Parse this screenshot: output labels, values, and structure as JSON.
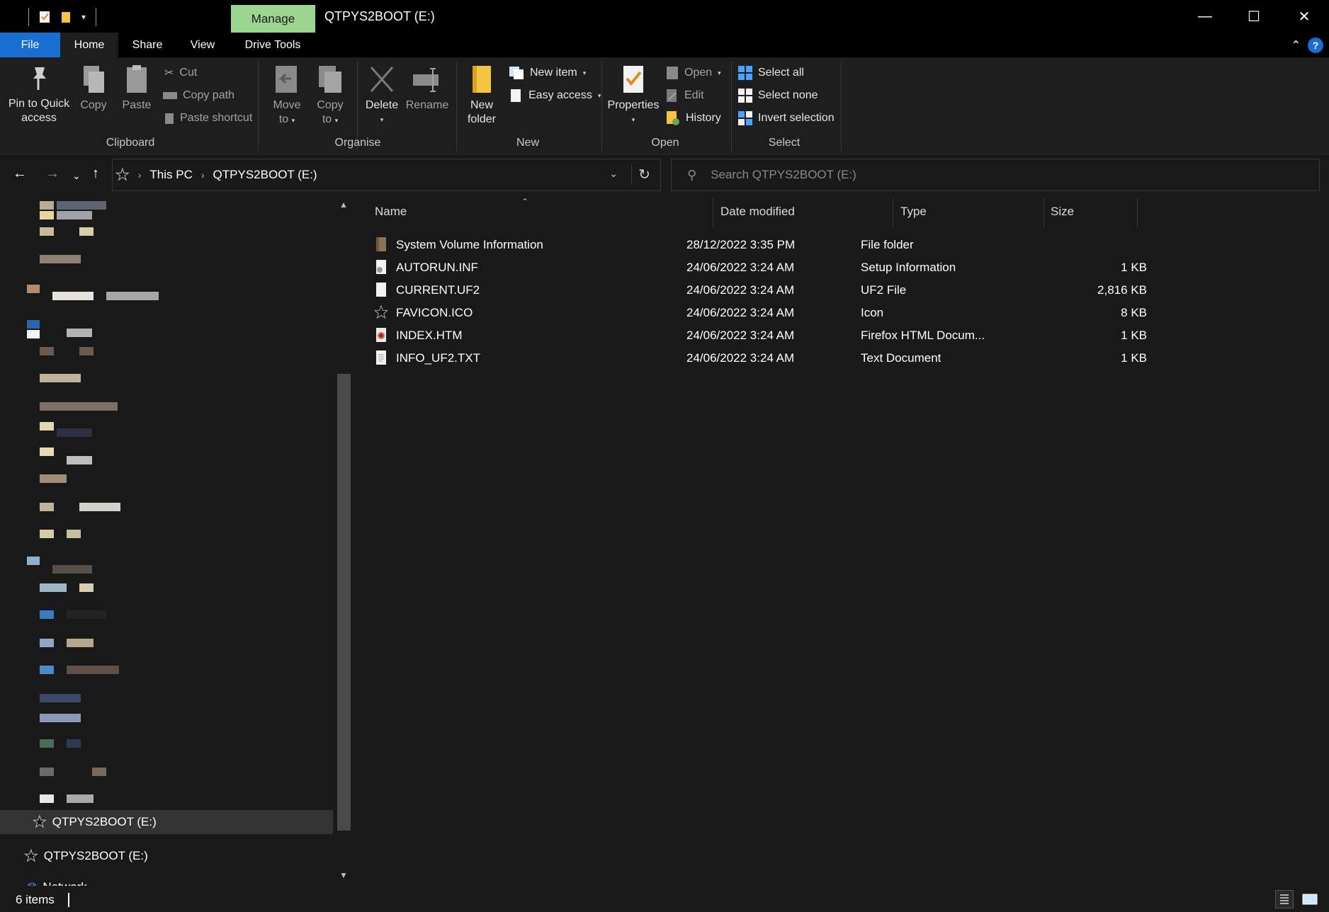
{
  "titlebar": {
    "manage_tab": "Manage",
    "title": "QTPYS2BOOT (E:)",
    "minimize_glyph": "—",
    "maximize_glyph": "☐",
    "close_glyph": "✕"
  },
  "tabs": {
    "file": "File",
    "home": "Home",
    "share": "Share",
    "view": "View",
    "drive_tools": "Drive Tools"
  },
  "ribbon": {
    "clipboard": {
      "label": "Clipboard",
      "pin": "Pin to Quick access",
      "pin_l1": "Pin to Quick",
      "pin_l2": "access",
      "copy": "Copy",
      "paste": "Paste",
      "cut": "Cut",
      "copy_path": "Copy path",
      "paste_shortcut": "Paste shortcut"
    },
    "organise": {
      "label": "Organise",
      "move_to_l1": "Move",
      "move_to_l2": "to",
      "copy_to_l1": "Copy",
      "copy_to_l2": "to",
      "delete": "Delete",
      "rename": "Rename"
    },
    "new": {
      "label": "New",
      "new_folder_l1": "New",
      "new_folder_l2": "folder",
      "new_item": "New item",
      "easy_access": "Easy access"
    },
    "open": {
      "label": "Open",
      "properties": "Properties",
      "open": "Open",
      "edit": "Edit",
      "history": "History"
    },
    "select": {
      "label": "Select",
      "select_all": "Select all",
      "select_none": "Select none",
      "invert_selection": "Invert selection"
    }
  },
  "address": {
    "crumbs": [
      "This PC",
      "QTPYS2BOOT (E:)"
    ],
    "search_placeholder": "Search QTPYS2BOOT (E:)"
  },
  "navpane": {
    "selected_item": "QTPYS2BOOT (E:)",
    "drive_item": "QTPYS2BOOT (E:)",
    "partial_item": "Network"
  },
  "columns": {
    "name": "Name",
    "date": "Date modified",
    "type": "Type",
    "size": "Size"
  },
  "files": [
    {
      "name": "System Volume Information",
      "date": "28/12/2022 3:35 PM",
      "type": "File folder",
      "size": "",
      "icon": "folder-icon"
    },
    {
      "name": "AUTORUN.INF",
      "date": "24/06/2022 3:24 AM",
      "type": "Setup Information",
      "size": "1 KB",
      "icon": "setup-file-icon"
    },
    {
      "name": "CURRENT.UF2",
      "date": "24/06/2022 3:24 AM",
      "type": "UF2 File",
      "size": "2,816 KB",
      "icon": "blank-file-icon"
    },
    {
      "name": "FAVICON.ICO",
      "date": "24/06/2022 3:24 AM",
      "type": "Icon",
      "size": "8 KB",
      "icon": "star-icon"
    },
    {
      "name": "INDEX.HTM",
      "date": "24/06/2022 3:24 AM",
      "type": "Firefox HTML Docum...",
      "size": "1 KB",
      "icon": "firefox-icon"
    },
    {
      "name": "INFO_UF2.TXT",
      "date": "24/06/2022 3:24 AM",
      "type": "Text Document",
      "size": "1 KB",
      "icon": "text-file-icon"
    }
  ],
  "status": {
    "count": "6 items"
  },
  "colors": {
    "accent": "#1a6ed2",
    "manage_tab": "#9bd58f",
    "background": "#191919"
  }
}
